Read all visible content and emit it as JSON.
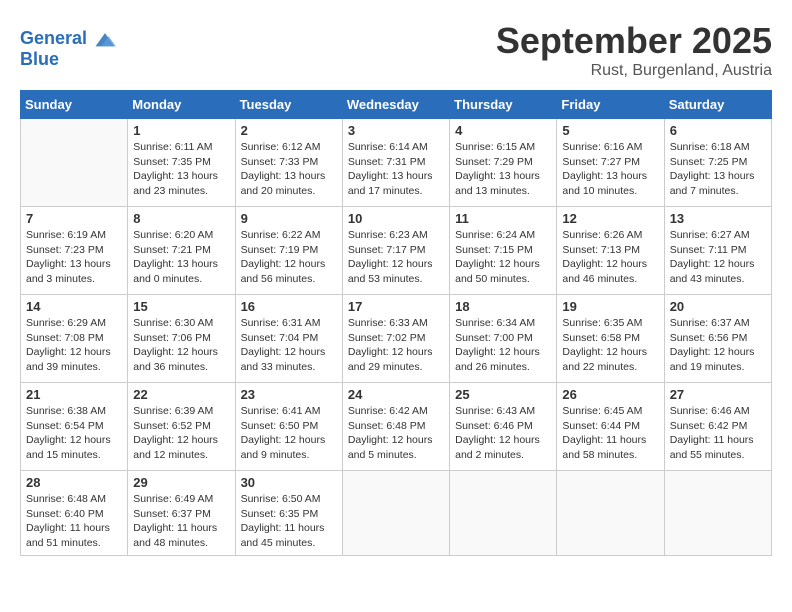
{
  "header": {
    "logo_line1": "General",
    "logo_line2": "Blue",
    "month": "September 2025",
    "location": "Rust, Burgenland, Austria"
  },
  "weekdays": [
    "Sunday",
    "Monday",
    "Tuesday",
    "Wednesday",
    "Thursday",
    "Friday",
    "Saturday"
  ],
  "weeks": [
    [
      {
        "day": "",
        "info": ""
      },
      {
        "day": "1",
        "info": "Sunrise: 6:11 AM\nSunset: 7:35 PM\nDaylight: 13 hours\nand 23 minutes."
      },
      {
        "day": "2",
        "info": "Sunrise: 6:12 AM\nSunset: 7:33 PM\nDaylight: 13 hours\nand 20 minutes."
      },
      {
        "day": "3",
        "info": "Sunrise: 6:14 AM\nSunset: 7:31 PM\nDaylight: 13 hours\nand 17 minutes."
      },
      {
        "day": "4",
        "info": "Sunrise: 6:15 AM\nSunset: 7:29 PM\nDaylight: 13 hours\nand 13 minutes."
      },
      {
        "day": "5",
        "info": "Sunrise: 6:16 AM\nSunset: 7:27 PM\nDaylight: 13 hours\nand 10 minutes."
      },
      {
        "day": "6",
        "info": "Sunrise: 6:18 AM\nSunset: 7:25 PM\nDaylight: 13 hours\nand 7 minutes."
      }
    ],
    [
      {
        "day": "7",
        "info": "Sunrise: 6:19 AM\nSunset: 7:23 PM\nDaylight: 13 hours\nand 3 minutes."
      },
      {
        "day": "8",
        "info": "Sunrise: 6:20 AM\nSunset: 7:21 PM\nDaylight: 13 hours\nand 0 minutes."
      },
      {
        "day": "9",
        "info": "Sunrise: 6:22 AM\nSunset: 7:19 PM\nDaylight: 12 hours\nand 56 minutes."
      },
      {
        "day": "10",
        "info": "Sunrise: 6:23 AM\nSunset: 7:17 PM\nDaylight: 12 hours\nand 53 minutes."
      },
      {
        "day": "11",
        "info": "Sunrise: 6:24 AM\nSunset: 7:15 PM\nDaylight: 12 hours\nand 50 minutes."
      },
      {
        "day": "12",
        "info": "Sunrise: 6:26 AM\nSunset: 7:13 PM\nDaylight: 12 hours\nand 46 minutes."
      },
      {
        "day": "13",
        "info": "Sunrise: 6:27 AM\nSunset: 7:11 PM\nDaylight: 12 hours\nand 43 minutes."
      }
    ],
    [
      {
        "day": "14",
        "info": "Sunrise: 6:29 AM\nSunset: 7:08 PM\nDaylight: 12 hours\nand 39 minutes."
      },
      {
        "day": "15",
        "info": "Sunrise: 6:30 AM\nSunset: 7:06 PM\nDaylight: 12 hours\nand 36 minutes."
      },
      {
        "day": "16",
        "info": "Sunrise: 6:31 AM\nSunset: 7:04 PM\nDaylight: 12 hours\nand 33 minutes."
      },
      {
        "day": "17",
        "info": "Sunrise: 6:33 AM\nSunset: 7:02 PM\nDaylight: 12 hours\nand 29 minutes."
      },
      {
        "day": "18",
        "info": "Sunrise: 6:34 AM\nSunset: 7:00 PM\nDaylight: 12 hours\nand 26 minutes."
      },
      {
        "day": "19",
        "info": "Sunrise: 6:35 AM\nSunset: 6:58 PM\nDaylight: 12 hours\nand 22 minutes."
      },
      {
        "day": "20",
        "info": "Sunrise: 6:37 AM\nSunset: 6:56 PM\nDaylight: 12 hours\nand 19 minutes."
      }
    ],
    [
      {
        "day": "21",
        "info": "Sunrise: 6:38 AM\nSunset: 6:54 PM\nDaylight: 12 hours\nand 15 minutes."
      },
      {
        "day": "22",
        "info": "Sunrise: 6:39 AM\nSunset: 6:52 PM\nDaylight: 12 hours\nand 12 minutes."
      },
      {
        "day": "23",
        "info": "Sunrise: 6:41 AM\nSunset: 6:50 PM\nDaylight: 12 hours\nand 9 minutes."
      },
      {
        "day": "24",
        "info": "Sunrise: 6:42 AM\nSunset: 6:48 PM\nDaylight: 12 hours\nand 5 minutes."
      },
      {
        "day": "25",
        "info": "Sunrise: 6:43 AM\nSunset: 6:46 PM\nDaylight: 12 hours\nand 2 minutes."
      },
      {
        "day": "26",
        "info": "Sunrise: 6:45 AM\nSunset: 6:44 PM\nDaylight: 11 hours\nand 58 minutes."
      },
      {
        "day": "27",
        "info": "Sunrise: 6:46 AM\nSunset: 6:42 PM\nDaylight: 11 hours\nand 55 minutes."
      }
    ],
    [
      {
        "day": "28",
        "info": "Sunrise: 6:48 AM\nSunset: 6:40 PM\nDaylight: 11 hours\nand 51 minutes."
      },
      {
        "day": "29",
        "info": "Sunrise: 6:49 AM\nSunset: 6:37 PM\nDaylight: 11 hours\nand 48 minutes."
      },
      {
        "day": "30",
        "info": "Sunrise: 6:50 AM\nSunset: 6:35 PM\nDaylight: 11 hours\nand 45 minutes."
      },
      {
        "day": "",
        "info": ""
      },
      {
        "day": "",
        "info": ""
      },
      {
        "day": "",
        "info": ""
      },
      {
        "day": "",
        "info": ""
      }
    ]
  ]
}
